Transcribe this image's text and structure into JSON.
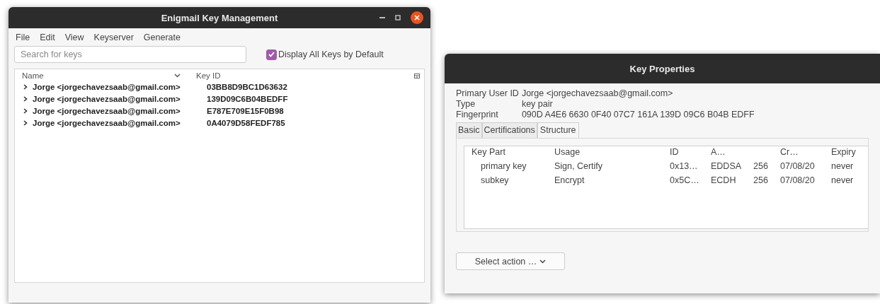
{
  "key_management": {
    "title": "Enigmail Key Management",
    "menu": [
      "File",
      "Edit",
      "View",
      "Keyserver",
      "Generate"
    ],
    "search": {
      "placeholder": "Search for keys"
    },
    "display_all": {
      "label": "Display All Keys by Default",
      "checked": true
    },
    "key_list": {
      "columns": [
        "Name",
        "Key ID"
      ],
      "rows": [
        {
          "name": "Jorge <jorgechavezsaab@gmail.com>",
          "key_id": "03BB8D9BC1D63632",
          "expanded": false
        },
        {
          "name": "Jorge <jorgechavezsaab@gmail.com>",
          "key_id": "139D09C6B04BEDFF",
          "expanded": false
        },
        {
          "name": "Jorge <jorgechavezsaab@gmail.com>",
          "key_id": "E787E709E15F0B98",
          "expanded": false
        },
        {
          "name": "Jorge <jorgechavezsaab@gmail.com>",
          "key_id": "0A4079D58FEDF785",
          "expanded": false
        }
      ]
    }
  },
  "key_properties": {
    "title": "Key Properties",
    "fields": [
      {
        "label": "Primary User ID",
        "value": "Jorge <jorgechavezsaab@gmail.com>"
      },
      {
        "label": "Type",
        "value": "key pair"
      },
      {
        "label": "Fingerprint",
        "value": "090D A4E6 6630 0F40 07C7 161A 139D 09C6 B04B EDFF"
      }
    ],
    "tabs": [
      {
        "label": "Basic",
        "selected": false
      },
      {
        "label": "Certifications",
        "selected": false
      },
      {
        "label": "Structure",
        "selected": true
      }
    ],
    "structure": {
      "headers": {
        "key_part": "Key Part",
        "usage": "Usage",
        "id": "ID",
        "column_4": "A…",
        "created": "Cr…",
        "expiry": "Expiry"
      },
      "rows": [
        {
          "key_part": "primary key",
          "usage": "Sign, Certify",
          "id": "0x13…",
          "column_4": "EDDSA",
          "size": "256",
          "created": "07/08/20",
          "expiry": "never"
        },
        {
          "key_part": "subkey",
          "usage": "Encrypt",
          "id": "0x5C…",
          "column_4": "ECDH",
          "size": "256",
          "created": "07/08/20",
          "expiry": "never"
        }
      ]
    },
    "action_button": "Select action …"
  }
}
